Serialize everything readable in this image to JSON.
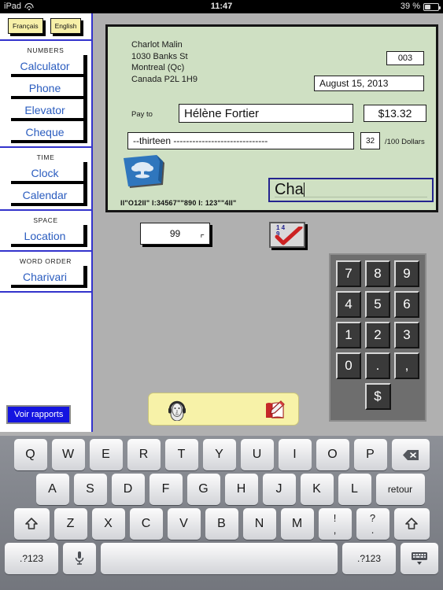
{
  "statusbar": {
    "device": "iPad",
    "wifi_icon": "wifi-icon",
    "time": "11:47",
    "battery_pct": "39 %",
    "battery_icon": "battery-icon"
  },
  "sidebar": {
    "languages": [
      {
        "label": "Français",
        "name": "lang-francais"
      },
      {
        "label": "English",
        "name": "lang-english"
      }
    ],
    "sections": [
      {
        "label": "NUMBERS",
        "items": [
          {
            "label": "Calculator"
          },
          {
            "label": "Phone"
          },
          {
            "label": "Elevator"
          },
          {
            "label": "Cheque"
          }
        ]
      },
      {
        "label": "TIME",
        "items": [
          {
            "label": "Clock"
          },
          {
            "label": "Calendar"
          }
        ]
      },
      {
        "label": "SPACE",
        "items": [
          {
            "label": "Location"
          }
        ]
      },
      {
        "label": "WORD ORDER",
        "items": [
          {
            "label": "Charivari"
          }
        ]
      }
    ],
    "reports_button": "Voir rapports"
  },
  "cheque": {
    "payer": {
      "name": "Charlot Malin",
      "street": "1030 Banks St",
      "city": "Montreal (Qc)",
      "country": "Canada P2L 1H9"
    },
    "cheque_number": "003",
    "date": "August 15, 2013",
    "pay_to_label": "Pay to",
    "payee": "Hélène Fortier",
    "amount": "$13.32",
    "amount_words": "--thirteen ------------------------------",
    "cents": "32",
    "dollars_label": "/100 Dollars",
    "micr_line": "II\"O12II\"  I:34567\"\"890 I:    123\"\"4II\"",
    "signature": "Cha",
    "bank_logo_icon": "bank-tree-logo-icon",
    "paper_color": "#cfe0c3"
  },
  "widgets": {
    "counter_value": "99",
    "counter_return_icon": "return-arrow-icon",
    "check_button_icon": "check-answer-icon",
    "check_button_numbers_top": "1 4",
    "check_button_numbers_bottom": "9"
  },
  "keypad": {
    "rows": [
      [
        "7",
        "8",
        "9"
      ],
      [
        "4",
        "5",
        "6"
      ],
      [
        "1",
        "2",
        "3"
      ],
      [
        "0",
        ".",
        ","
      ]
    ],
    "currency_key": "$"
  },
  "audiobar": {
    "listen_icon": "headphones-face-icon",
    "write_icon": "notebook-pen-icon",
    "background": "#f7f2a8"
  },
  "keyboard": {
    "row1": [
      "Q",
      "W",
      "E",
      "R",
      "T",
      "Y",
      "U",
      "I",
      "O",
      "P"
    ],
    "backspace_icon": "backspace-icon",
    "row2": [
      "A",
      "S",
      "D",
      "F",
      "G",
      "H",
      "J",
      "K",
      "L"
    ],
    "return_label": "retour",
    "shift_icon": "shift-icon",
    "row3": [
      "Z",
      "X",
      "C",
      "V",
      "B",
      "N",
      "M"
    ],
    "dual1": {
      "top": "!",
      "bottom": ","
    },
    "dual2": {
      "top": "?",
      "bottom": "."
    },
    "numbers_label": ".?123",
    "mic_icon": "microphone-icon",
    "space_label": "",
    "dismiss_icon": "hide-keyboard-icon"
  }
}
